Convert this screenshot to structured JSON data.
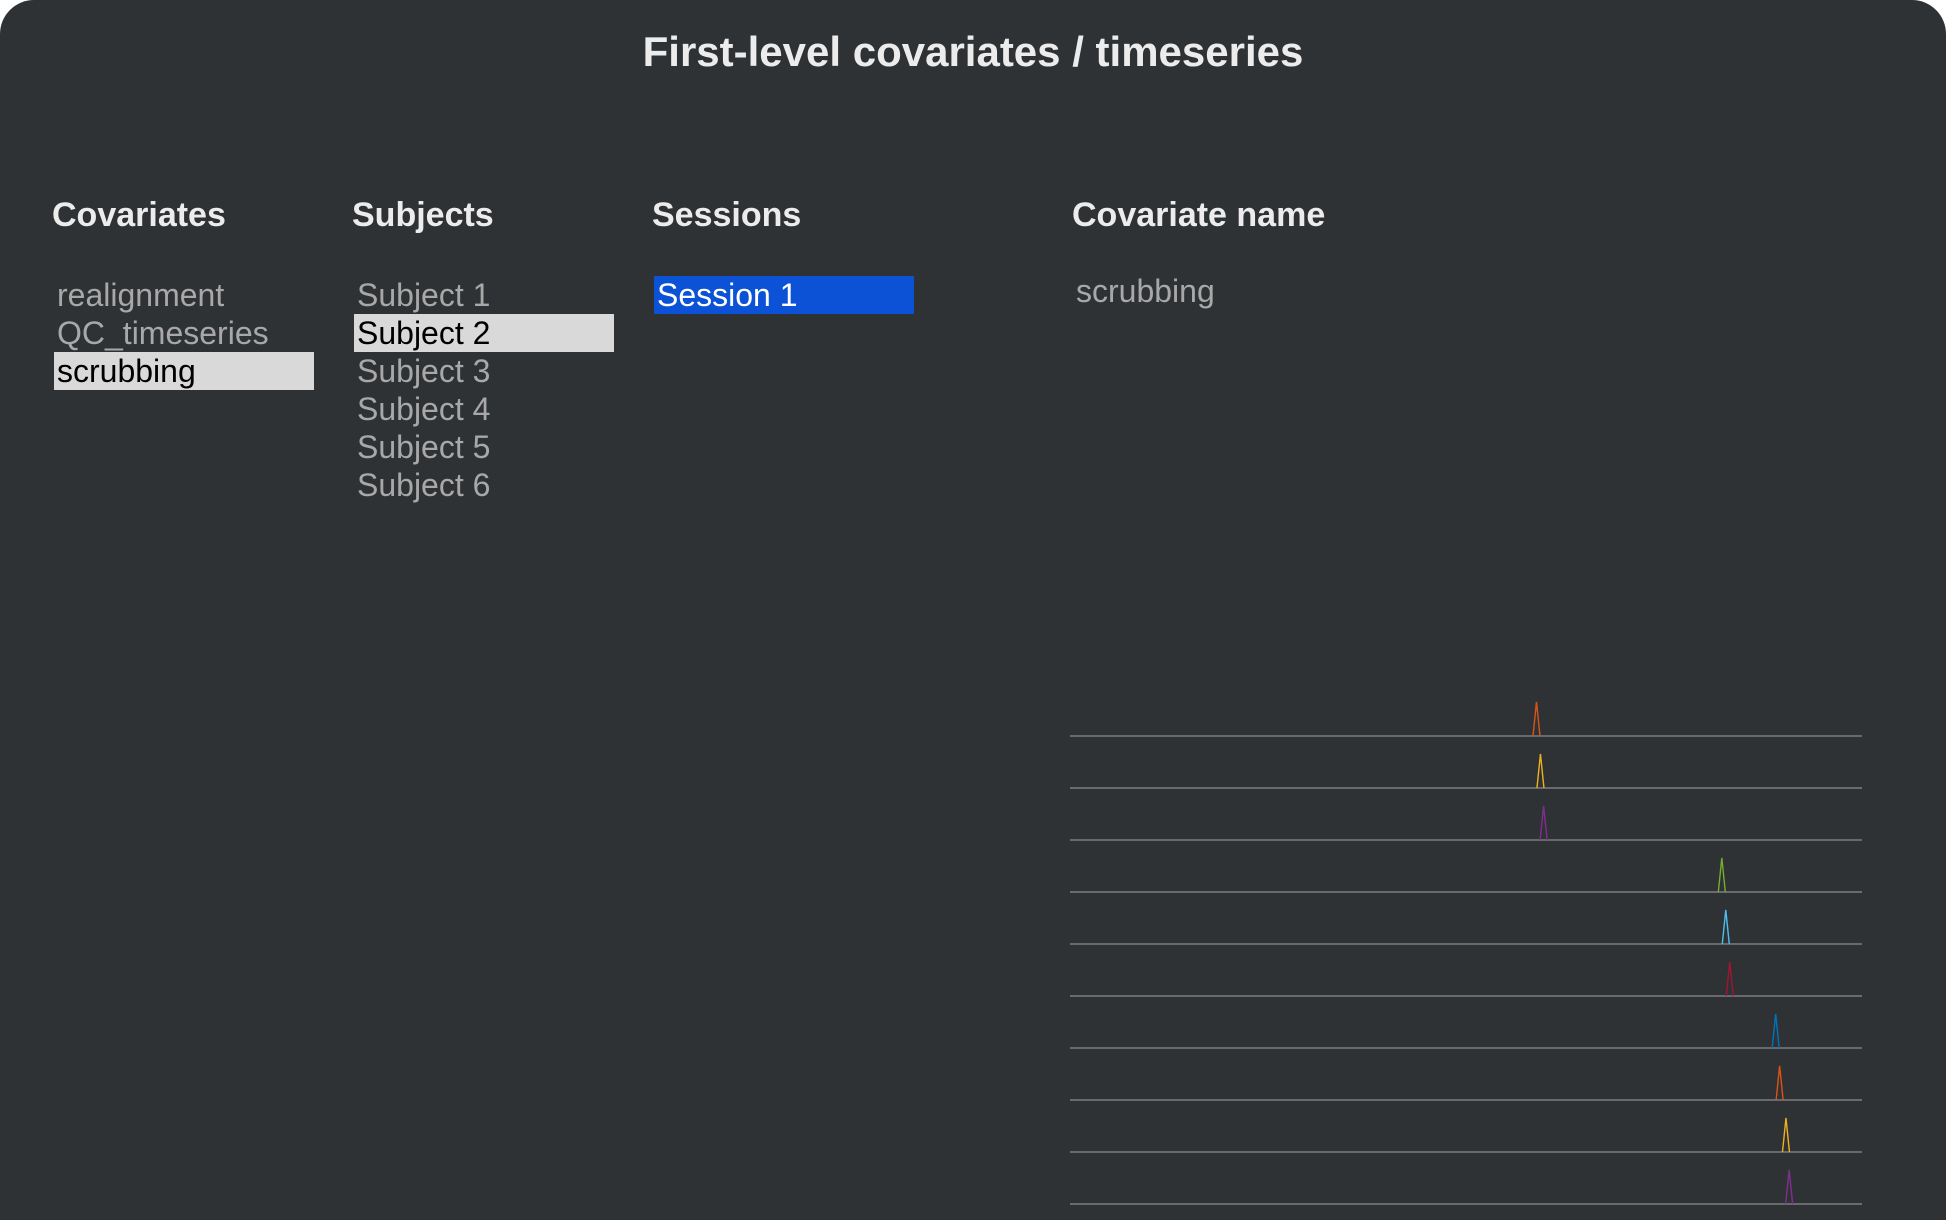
{
  "window": {
    "title": "First-level covariates / timeseries"
  },
  "covariates": {
    "heading": "Covariates",
    "items": [
      {
        "label": "realignment",
        "selected": false
      },
      {
        "label": "QC_timeseries",
        "selected": false
      },
      {
        "label": "scrubbing",
        "selected": true
      }
    ]
  },
  "subjects": {
    "heading": "Subjects",
    "items": [
      {
        "label": "Subject 1",
        "selected": false
      },
      {
        "label": "Subject 2",
        "selected": true
      },
      {
        "label": "Subject 3",
        "selected": false
      },
      {
        "label": "Subject 4",
        "selected": false
      },
      {
        "label": "Subject 5",
        "selected": false
      },
      {
        "label": "Subject 6",
        "selected": false
      }
    ]
  },
  "sessions": {
    "heading": "Sessions",
    "items": [
      {
        "label": "Session 1",
        "selected": true
      }
    ]
  },
  "covariate_name": {
    "heading": "Covariate name",
    "value": "scrubbing"
  },
  "colors": {
    "background": "#2f3235",
    "text": "#ececec",
    "muted_text": "#a8a8a8",
    "selection_gray": "#d9d9d9",
    "selection_blue": "#0b52d6",
    "baseline": "#8a8c8e"
  },
  "chart_data": {
    "type": "line",
    "description_units": "fraction of timeseries length",
    "series": [
      {
        "spike_at": 0.589,
        "color": "#d95319"
      },
      {
        "spike_at": 0.594,
        "color": "#edb120"
      },
      {
        "spike_at": 0.598,
        "color": "#7e2f8e"
      },
      {
        "spike_at": 0.823,
        "color": "#77ac30"
      },
      {
        "spike_at": 0.828,
        "color": "#4dbeee"
      },
      {
        "spike_at": 0.833,
        "color": "#a2142f"
      },
      {
        "spike_at": 0.891,
        "color": "#0072bd"
      },
      {
        "spike_at": 0.896,
        "color": "#d95319"
      },
      {
        "spike_at": 0.904,
        "color": "#edb120"
      },
      {
        "spike_at": 0.908,
        "color": "#7e2f8e"
      }
    ]
  }
}
